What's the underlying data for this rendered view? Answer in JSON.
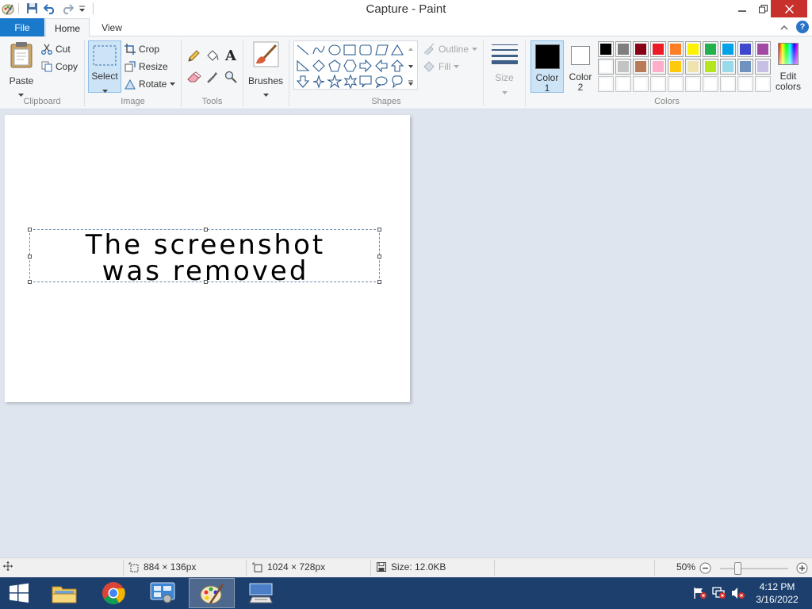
{
  "window": {
    "title": "Capture - Paint"
  },
  "tabs": {
    "file": "File",
    "home": "Home",
    "view": "View"
  },
  "ribbon": {
    "clipboard": {
      "paste": "Paste",
      "cut": "Cut",
      "copy": "Copy",
      "label": "Clipboard"
    },
    "image": {
      "select": "Select",
      "crop": "Crop",
      "resize": "Resize",
      "rotate": "Rotate",
      "label": "Image"
    },
    "tools": {
      "label": "Tools"
    },
    "brushes": {
      "label": "Brushes"
    },
    "shapes": {
      "outline": "Outline",
      "fill": "Fill",
      "label": "Shapes"
    },
    "size": {
      "label": "Size"
    },
    "color1": {
      "label": "Color",
      "num": "1",
      "value": "#000000"
    },
    "color2": {
      "label": "Color",
      "num": "2",
      "value": "#ffffff"
    },
    "colors": {
      "label": "Colors",
      "edit_line1": "Edit",
      "edit_line2": "colors",
      "palette_row1": [
        "#000000",
        "#7f7f7f",
        "#880015",
        "#ed1c24",
        "#ff7f27",
        "#fff200",
        "#22b14c",
        "#00a2e8",
        "#3f48cc",
        "#a349a4"
      ],
      "palette_row2": [
        "#ffffff",
        "#c3c3c3",
        "#b97a57",
        "#ffaec9",
        "#ffc90e",
        "#efe4b0",
        "#b5e61d",
        "#99d9ea",
        "#7092be",
        "#c8bfe7"
      ],
      "palette_row3": [
        "#ffffff",
        "#ffffff",
        "#ffffff",
        "#ffffff",
        "#ffffff",
        "#ffffff",
        "#ffffff",
        "#ffffff",
        "#ffffff",
        "#ffffff"
      ]
    }
  },
  "canvas": {
    "text_line1": "The screenshot",
    "text_line2": "was removed"
  },
  "status": {
    "selection_size": "884 × 136px",
    "image_size": "1024 × 728px",
    "file_size": "Size: 12.0KB",
    "zoom": "50%",
    "zoom_fraction": 0.25
  },
  "taskbar": {
    "time": "4:12 PM",
    "date": "3/16/2022"
  }
}
